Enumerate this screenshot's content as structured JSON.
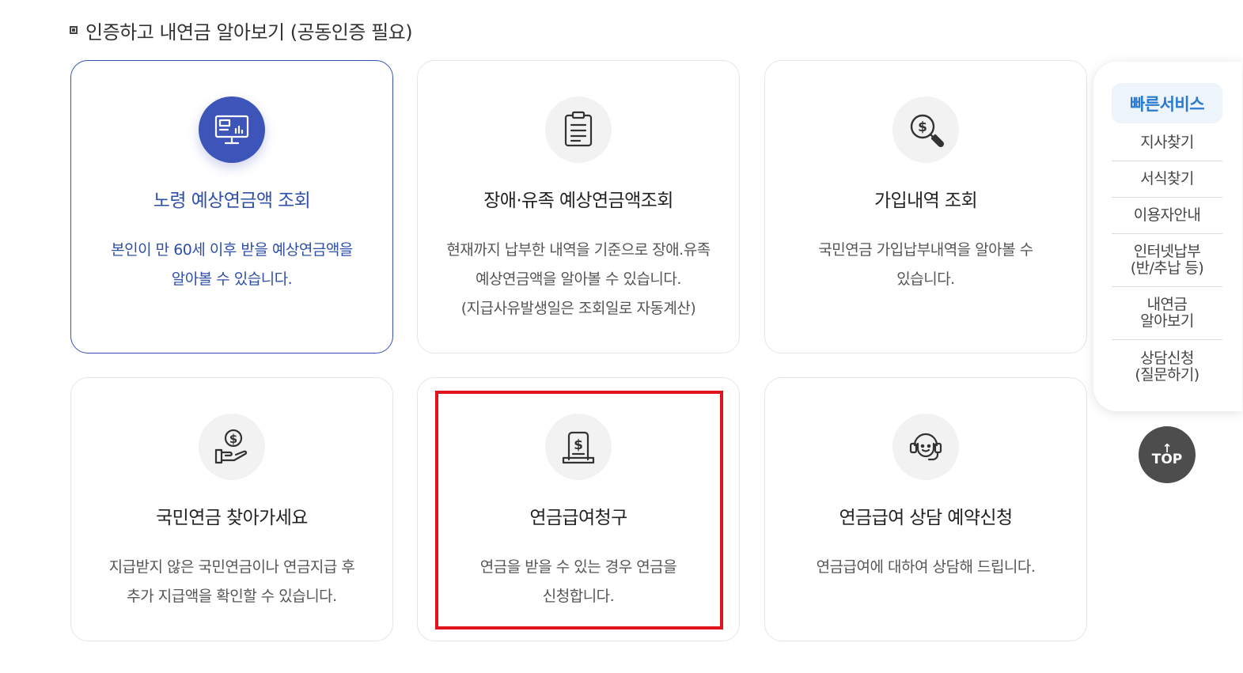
{
  "section": {
    "title": "인증하고 내연금 알아보기 (공동인증 필요)"
  },
  "cards": [
    {
      "title": "노령 예상연금액 조회",
      "desc": [
        "본인이 만 60세 이후 받을 예상연금액을",
        "알아볼 수 있습니다."
      ],
      "icon": "monitor-chart-icon"
    },
    {
      "title": "장애·유족 예상연금액조회",
      "desc": [
        "현재까지 납부한 내역을 기준으로 장애.유족",
        "예상연금액을 알아볼 수 있습니다.",
        "(지급사유발생일은 조회일로 자동계산)"
      ],
      "icon": "clipboard-icon"
    },
    {
      "title": "가입내역 조회",
      "desc": [
        "국민연금 가입납부내역을 알아볼 수",
        "있습니다."
      ],
      "icon": "dollar-search-icon"
    },
    {
      "title": "국민연금 찾아가세요",
      "desc": [
        "지급받지 않은 국민연금이나 연금지급 후",
        "추가 지급액을 확인할 수 있습니다."
      ],
      "icon": "hand-coin-icon"
    },
    {
      "title": "연금급여청구",
      "desc": [
        "연금을 받을 수 있는 경우 연금을",
        "신청합니다."
      ],
      "icon": "dollar-document-icon"
    },
    {
      "title": "연금급여 상담 예약신청",
      "desc": [
        "연금급여에 대하여 상담해 드립니다."
      ],
      "icon": "headset-icon"
    }
  ],
  "quick_menu": {
    "title": "빠른서비스",
    "items": [
      "지사찾기",
      "서식찾기",
      "이용자안내",
      "인터넷납부\n(반/추납 등)",
      "내연금\n알아보기",
      "상담신청\n(질문하기)"
    ]
  },
  "top_button": {
    "label": "TOP",
    "arrow": "↑"
  },
  "colors": {
    "accent": "#3d55b8",
    "quick_accent": "#2a7ad0",
    "highlight": "#e0151c"
  }
}
